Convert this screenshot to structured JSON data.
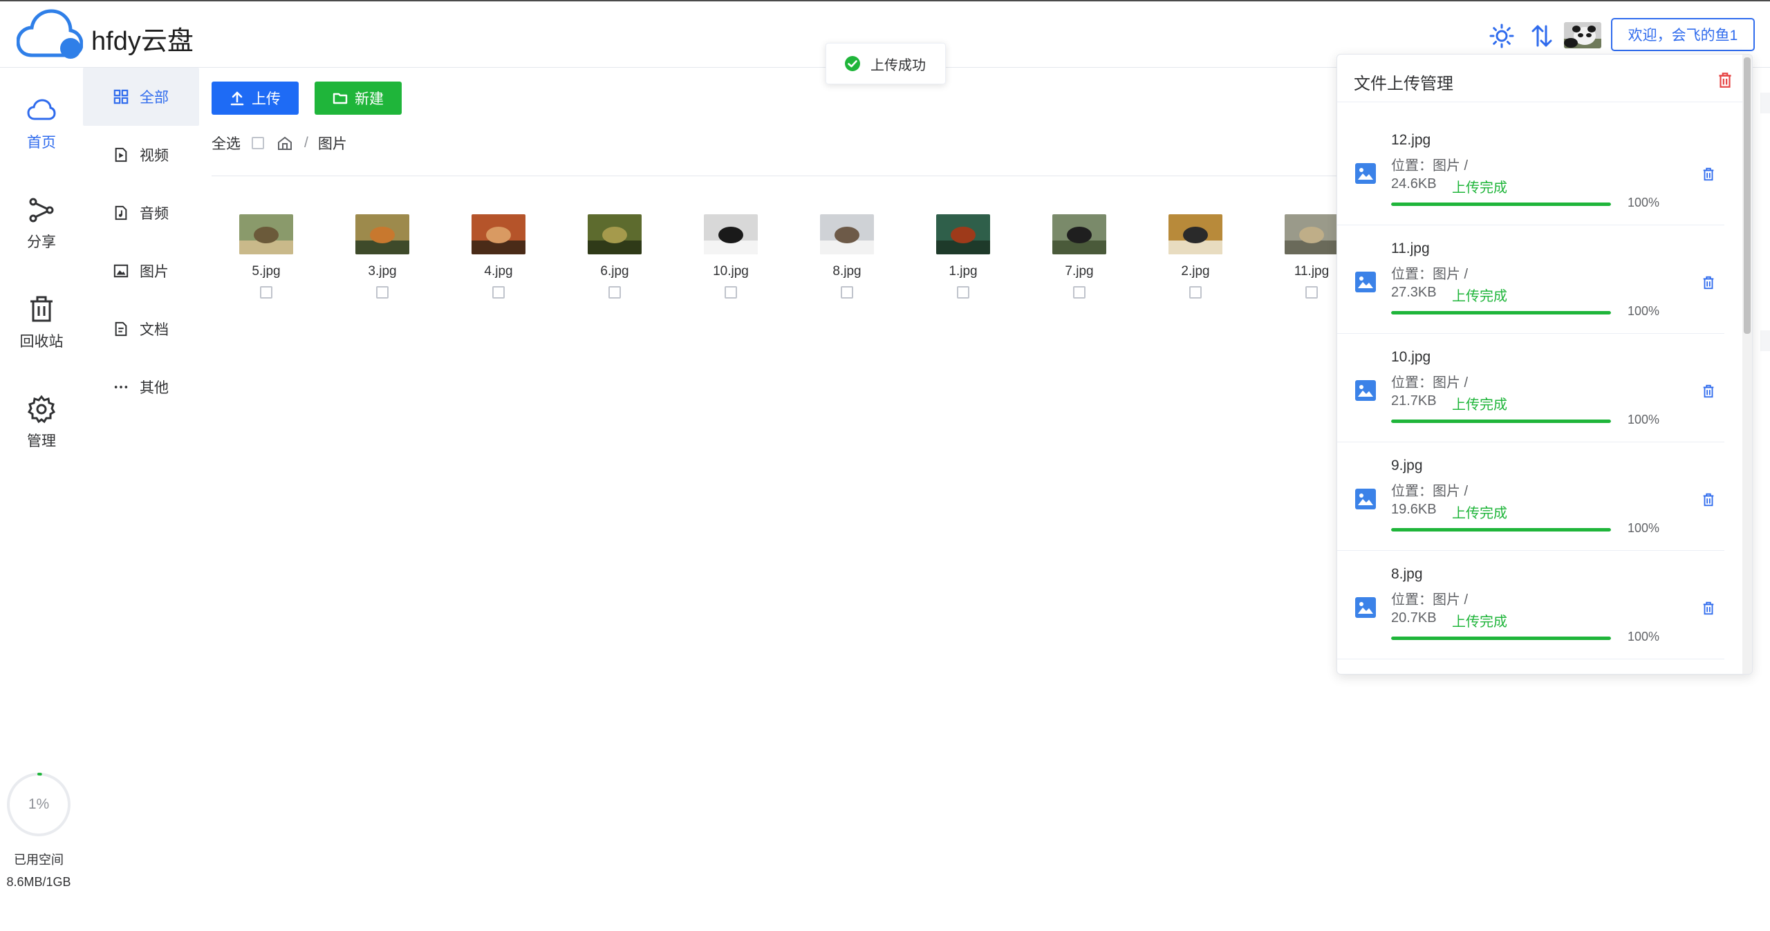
{
  "app": {
    "title": "hfdy云盘"
  },
  "header": {
    "welcome": "欢迎，会飞的鱼1",
    "icons": [
      "sun-icon",
      "transfer-icon"
    ]
  },
  "rail": [
    {
      "label": "首页",
      "icon": "cloud-icon",
      "active": true
    },
    {
      "label": "分享",
      "icon": "share-icon"
    },
    {
      "label": "回收站",
      "icon": "trash-icon"
    },
    {
      "label": "管理",
      "icon": "settings-icon"
    }
  ],
  "subnav": [
    {
      "label": "全部",
      "icon": "grid-icon",
      "active": true
    },
    {
      "label": "视频",
      "icon": "video-file-icon"
    },
    {
      "label": "音频",
      "icon": "audio-file-icon"
    },
    {
      "label": "图片",
      "icon": "image-file-icon"
    },
    {
      "label": "文档",
      "icon": "document-icon"
    },
    {
      "label": "其他",
      "icon": "more-icon"
    }
  ],
  "toolbar": {
    "upload_label": "上传",
    "new_label": "新建"
  },
  "breadcrumb": {
    "select_all": "全选",
    "separator": "/",
    "current": "图片"
  },
  "files": [
    {
      "name": "5.jpg"
    },
    {
      "name": "3.jpg"
    },
    {
      "name": "4.jpg"
    },
    {
      "name": "6.jpg"
    },
    {
      "name": "10.jpg"
    },
    {
      "name": "8.jpg"
    },
    {
      "name": "1.jpg"
    },
    {
      "name": "7.jpg"
    },
    {
      "name": "2.jpg"
    },
    {
      "name": "11.jpg"
    }
  ],
  "storage": {
    "percent": "1%",
    "label": "已用空间",
    "value": "8.6MB/1GB",
    "fraction": 0.01
  },
  "toast": {
    "message": "上传成功",
    "color": "#1fb53a"
  },
  "upload_panel": {
    "title": "文件上传管理",
    "items": [
      {
        "name": "12.jpg",
        "location": "位置：图片 /",
        "size": "24.6KB",
        "status": "上传完成",
        "percent": "100%",
        "progress": 1.0
      },
      {
        "name": "11.jpg",
        "location": "位置：图片 /",
        "size": "27.3KB",
        "status": "上传完成",
        "percent": "100%",
        "progress": 1.0
      },
      {
        "name": "10.jpg",
        "location": "位置：图片 /",
        "size": "21.7KB",
        "status": "上传完成",
        "percent": "100%",
        "progress": 1.0
      },
      {
        "name": "9.jpg",
        "location": "位置：图片 /",
        "size": "19.6KB",
        "status": "上传完成",
        "percent": "100%",
        "progress": 1.0
      },
      {
        "name": "8.jpg",
        "location": "位置：图片 /",
        "size": "20.7KB",
        "status": "上传完成",
        "percent": "100%",
        "progress": 1.0
      }
    ]
  },
  "colors": {
    "primary": "#2f6bed",
    "success": "#1fb53a",
    "danger": "#e64242"
  }
}
